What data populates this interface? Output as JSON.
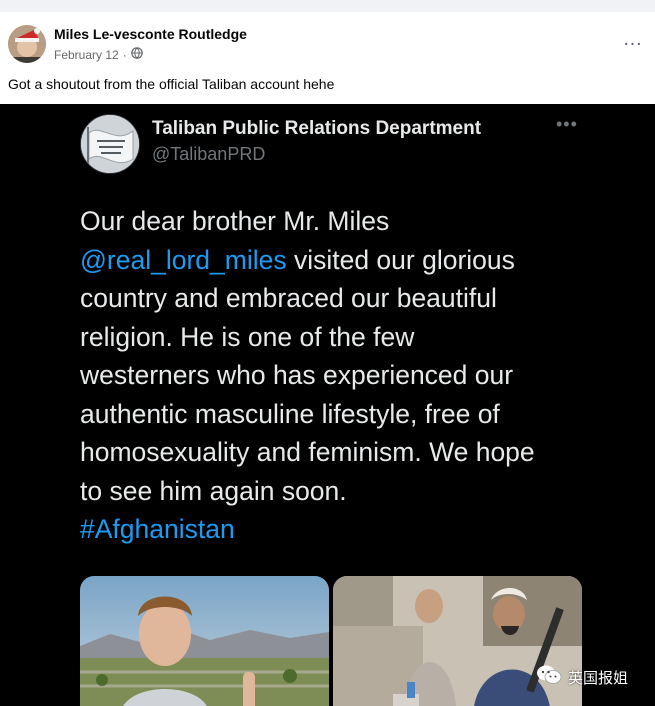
{
  "post": {
    "author": "Miles Le-vesconte Routledge",
    "date": "February 12",
    "privacy_icon": "globe-icon",
    "more_icon": "more-horizontal-icon",
    "text": "Got a shoutout from the official Taliban account hehe"
  },
  "tweet": {
    "display_name": "Taliban Public Relations Department",
    "handle": "@TalibanPRD",
    "more_icon": "more-horizontal-icon",
    "lines": [
      {
        "before": "Our dear brother Mr. Miles",
        "link": "",
        "after": ""
      },
      {
        "before": "",
        "link": "@real_lord_miles",
        "after": " visited our glorious"
      },
      {
        "before": "country and embraced our beautiful",
        "link": "",
        "after": ""
      },
      {
        "before": "religion. He is one of the few",
        "link": "",
        "after": ""
      },
      {
        "before": "westerners who has experienced our",
        "link": "",
        "after": ""
      },
      {
        "before": "authentic masculine lifestyle, free of",
        "link": "",
        "after": ""
      },
      {
        "before": "homosexuality and feminism. We hope",
        "link": "",
        "after": ""
      },
      {
        "before": "to see him again soon.",
        "link": "",
        "after": ""
      },
      {
        "before": "",
        "link": "#Afghanistan",
        "after": ""
      }
    ]
  },
  "watermark": {
    "text": "英国报姐",
    "icon": "wechat-icon"
  },
  "colors": {
    "tweet_background": "#000000",
    "tweet_text": "#e7e9ea",
    "link": "#1d9bf0",
    "muted": "#71767b"
  }
}
